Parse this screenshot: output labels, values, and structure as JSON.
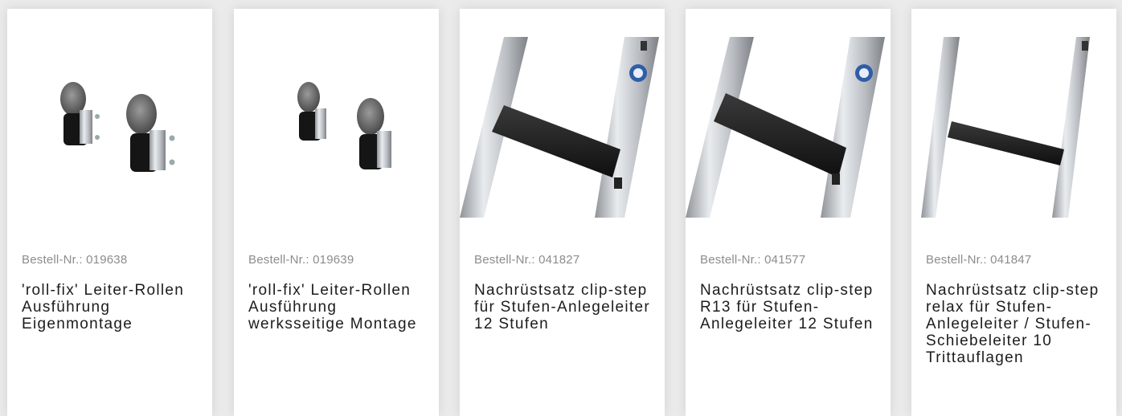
{
  "products": [
    {
      "order_label": "Bestell-Nr.: 019638",
      "title": "'roll-fix' Leiter-Rollen Ausführung Eigenmontage",
      "image": "ladder-wheels-image"
    },
    {
      "order_label": "Bestell-Nr.: 019639",
      "title": "'roll-fix' Leiter-Rollen Ausführung werksseitige Montage",
      "image": "ladder-wheels-image"
    },
    {
      "order_label": "Bestell-Nr.: 041827",
      "title": "Nachrüstsatz clip-step für Stufen-Anlegeleiter 12 Stufen",
      "image": "ladder-step-image"
    },
    {
      "order_label": "Bestell-Nr.: 041577",
      "title": "Nachrüstsatz clip-step R13 für Stufen-Anlegeleiter 12 Stufen",
      "image": "ladder-step-image"
    },
    {
      "order_label": "Bestell-Nr.: 041847",
      "title": "Nachrüstsatz clip-step relax für Stufen-Anlegeleiter / Stufen-Schiebeleiter 10 Trittauflagen",
      "image": "ladder-step-image"
    }
  ],
  "colors": {
    "page_bg": "#ebebeb",
    "card_bg": "#ffffff",
    "order_text": "#8c8c8c",
    "title_text": "#1c1c1c"
  }
}
